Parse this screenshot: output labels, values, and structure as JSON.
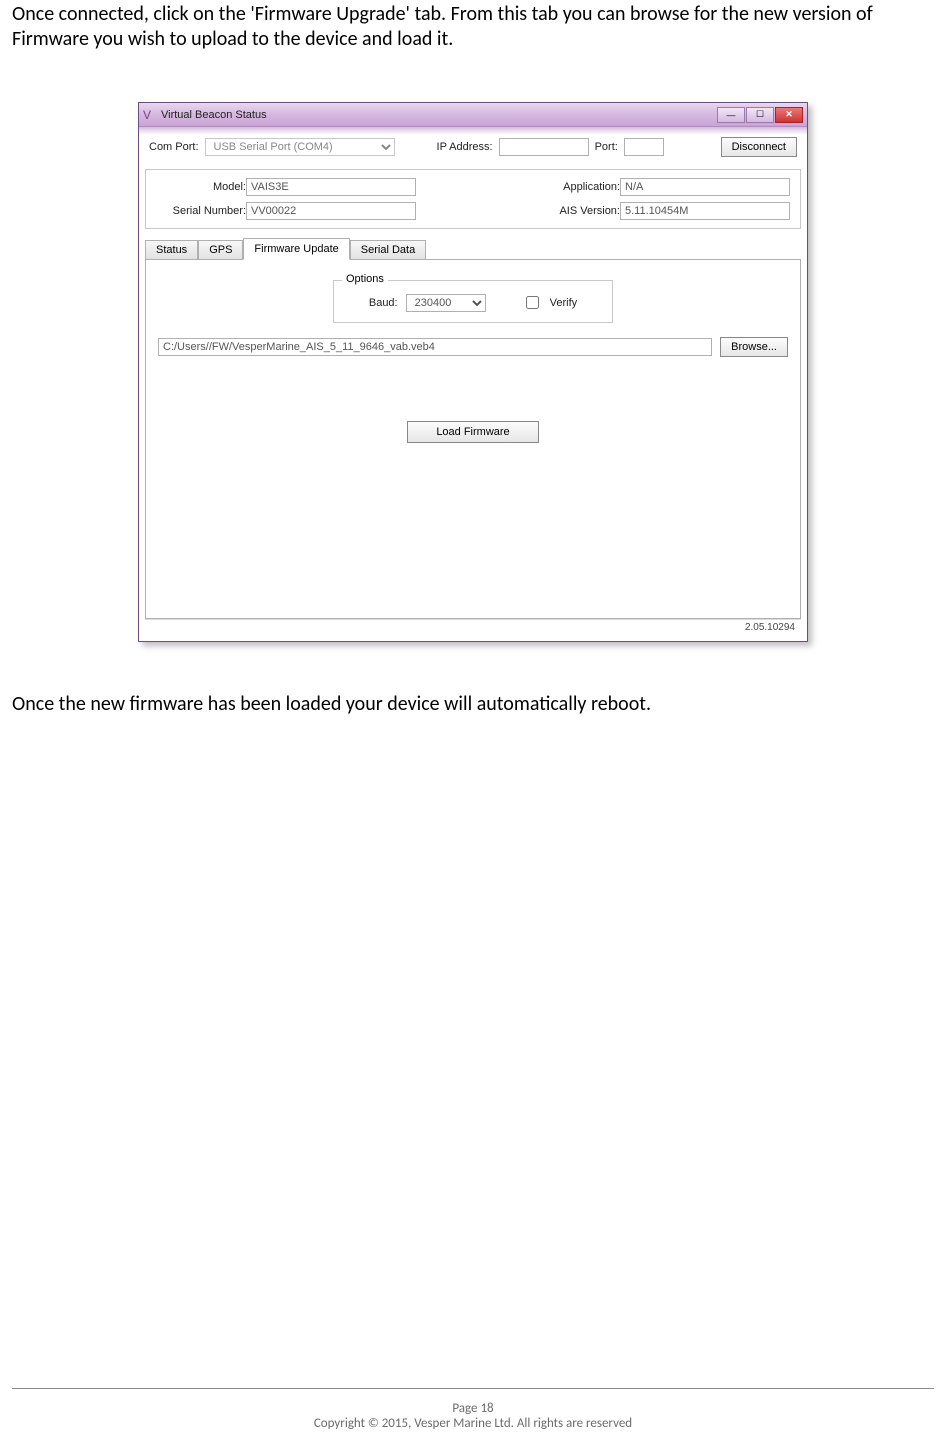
{
  "doc": {
    "para1": "Once connected, click on the 'Firmware Upgrade' tab. From this tab you can browse for the new version of Firmware you wish to upload to the device and load it.",
    "para2": "Once the new firmware has been loaded your device will automatically reboot."
  },
  "window": {
    "title": "Virtual Beacon Status",
    "min": "—",
    "max": "☐",
    "close": "✕"
  },
  "conn": {
    "comport_label": "Com Port:",
    "comport_value": "USB Serial Port (COM4)",
    "ip_label": "IP Address:",
    "ip_value": "",
    "port_label": "Port:",
    "port_value": "",
    "disconnect": "Disconnect"
  },
  "info": {
    "model_label": "Model:",
    "model_value": "VAIS3E",
    "serial_label": "Serial Number:",
    "serial_value": "VV00022",
    "app_label": "Application:",
    "app_value": "N/A",
    "ais_label": "AIS Version:",
    "ais_value": "5.11.10454M"
  },
  "tabs": {
    "status": "Status",
    "gps": "GPS",
    "firmware": "Firmware Update",
    "serial": "Serial Data"
  },
  "firmware": {
    "options_legend": "Options",
    "baud_label": "Baud:",
    "baud_value": "230400",
    "verify_label": "Verify",
    "file_path": "C:/Users//FW/VesperMarine_AIS_5_11_9646_vab.veb4",
    "browse": "Browse...",
    "load": "Load Firmware"
  },
  "status_footer": "2.05.10294",
  "page_footer": {
    "page": "Page 18",
    "copyright": "Copyright © 2015, Vesper Marine Ltd. All rights are reserved"
  }
}
